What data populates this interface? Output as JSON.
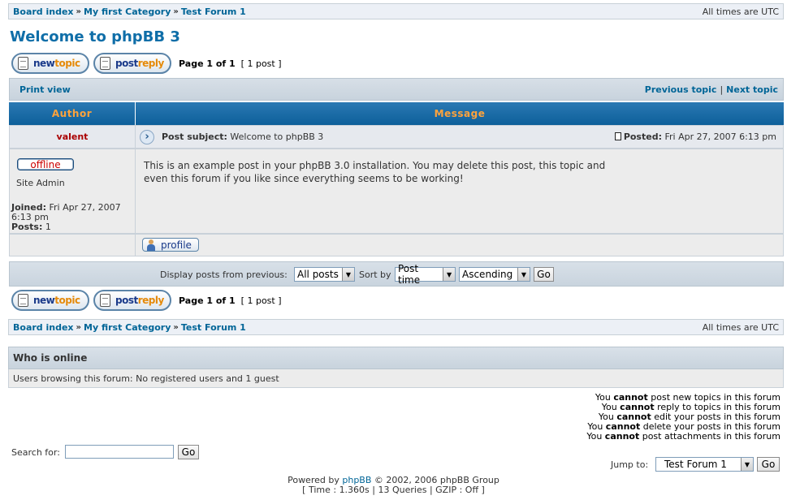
{
  "breadcrumb": {
    "items": [
      "Board index",
      "My first Category",
      "Test Forum 1"
    ],
    "separator": "»",
    "timezone": "All times are UTC"
  },
  "page_title": "Welcome to phpBB 3",
  "buttons": {
    "newtopic": {
      "part1": "new",
      "part2": "topic"
    },
    "postreply": {
      "part1": "post",
      "part2": "reply"
    },
    "profile": "profile"
  },
  "pagination": {
    "page_label": "Page 1 of 1",
    "post_count": "[ 1 post ]"
  },
  "topic_nav": {
    "print_view": "Print view",
    "previous_topic": "Previous topic",
    "divider": "|",
    "next_topic": "Next topic"
  },
  "table_headers": {
    "author": "Author",
    "message": "Message"
  },
  "post": {
    "author": "valent",
    "subject_label": "Post subject:",
    "subject": "Welcome to phpBB 3",
    "posted_label": "Posted:",
    "posted_date": "Fri Apr 27, 2007 6:13 pm",
    "status": "offline",
    "rank": "Site Admin",
    "joined_label": "Joined:",
    "joined_value": "Fri Apr 27, 2007",
    "joined_time": "6:13 pm",
    "posts_label": "Posts:",
    "posts_value": "1",
    "body_line1": "This is an example post in your phpBB 3.0 installation. You may delete this post, this topic and",
    "body_line2": "even this forum if you like since everything seems to be working!"
  },
  "sort_bar": {
    "display_label": "Display posts from previous:",
    "display_value": "All posts",
    "sort_label": "Sort by",
    "sort_value": "Post time",
    "order_value": "Ascending",
    "go": "Go"
  },
  "who_is_online": {
    "title": "Who is online",
    "text": "Users browsing this forum: No registered users and 1 guest"
  },
  "permissions": [
    {
      "pre": "You",
      "verb": "cannot",
      "post": "post new topics in this forum"
    },
    {
      "pre": "You",
      "verb": "cannot",
      "post": "reply to topics in this forum"
    },
    {
      "pre": "You",
      "verb": "cannot",
      "post": "edit your posts in this forum"
    },
    {
      "pre": "You",
      "verb": "cannot",
      "post": "delete your posts in this forum"
    },
    {
      "pre": "You",
      "verb": "cannot",
      "post": "post attachments in this forum"
    }
  ],
  "search": {
    "label": "Search for:",
    "value": "",
    "go": "Go"
  },
  "jump": {
    "label": "Jump to:",
    "value": "Test Forum 1",
    "go": "Go"
  },
  "footer": {
    "powered_pre": "Powered by",
    "powered_link": "phpBB",
    "powered_post": "© 2002, 2006 phpBB Group",
    "stats": "[ Time : 1.360s | 13 Queries | GZIP : Off ]"
  },
  "colors": {
    "link": "#006597",
    "header_bg": "#0d5f9a",
    "header_text": "#ffa33c",
    "author": "#aa0000"
  }
}
